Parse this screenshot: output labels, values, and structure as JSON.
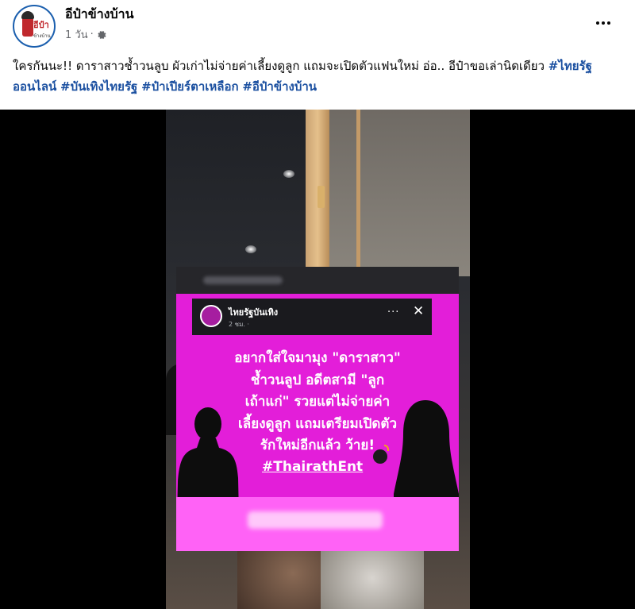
{
  "post": {
    "page_name": "อีป๋าข้างบ้าน",
    "time": "1 วัน",
    "meta_separator": "·",
    "caption_text": "ใครกันนะ!! ดาราสาวช้ำวนลูบ ผัวเก่าไม่จ่ายค่าเลี้ยงดูลูก แถมจะเปิดตัวแฟนใหม่ อ่อ.. อีป๋าขอเล่านิดเดียว ",
    "hashtags": [
      "#ไทยรัฐออนไลน์",
      "#บันเทิงไทยรัฐ",
      "#ป๋าเปียร์ตาเหลือก",
      "#อีป๋าข้างบ้าน"
    ],
    "avatar_text": "อีป๋า",
    "avatar_subtext": "ข้างบ้าน"
  },
  "media": {
    "inner_post": {
      "page_name": "ไทยรัฐบันเทิง",
      "time": "2 ชม. ·",
      "menu_dots": "···",
      "close": "✕"
    },
    "headline_lines": [
      "อยากใส่ใจมามุง \"ดาราสาว\"",
      "ช้ำวนลูป อดีตสามี \"ลูก",
      "เถ้าแก่\" รวยแต่ไม่จ่ายค่า",
      "เลี้ยงดูลูก แถมเตรียมเปิดตัว",
      "รักใหม่อีกแล้ว ว้าย!"
    ],
    "headline_hashtag": "#ThairathEnt"
  },
  "colors": {
    "hashtag": "#1a4fa0",
    "card_magenta": "#e31ed9",
    "avatar_ring": "#1b5fae"
  },
  "icons": [
    "gear-icon",
    "more-options-icon",
    "close-icon",
    "bomb-icon"
  ]
}
